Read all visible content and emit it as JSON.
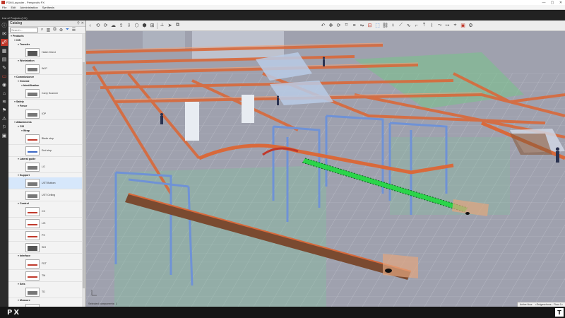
{
  "window": {
    "title": "FDM Layouter - Perspectiv PX",
    "minimize": "—",
    "maximize": "▢",
    "close": "✕"
  },
  "menu": [
    "File",
    "Edit",
    "Administration",
    "Synthesis"
  ],
  "project_label": "List of Projects (1/1)",
  "icons": {
    "sidebar": [
      "info-icon",
      "mail-icon",
      "catalog-icon",
      "grid-icon",
      "document-icon",
      "wrench-icon",
      "folder-icon",
      "eye-icon",
      "house-icon",
      "layers-icon",
      "flag-icon",
      "warning-icon",
      "flag-icon",
      "report-icon"
    ],
    "toolbar": [
      "undo-icon",
      "redo-icon",
      "cloud-icon",
      "cloud-upload-icon",
      "cloud-download-icon",
      "cube-icon",
      "cube-edit-icon",
      "cube-add-icon",
      "measure-icon",
      "arrow-icon",
      "copy-icon"
    ]
  },
  "colors": {
    "accent": "#c0392b",
    "conveyor": "#d9693a",
    "frame": "#6f92d6",
    "select": "#2bd44a"
  },
  "catalog": {
    "title": "Catalog",
    "search_placeholder": "Search...",
    "tree": [
      {
        "type": "group",
        "depth": 0,
        "label": "Products"
      },
      {
        "type": "group",
        "depth": 1,
        "label": "CIS"
      },
      {
        "type": "group",
        "depth": 2,
        "label": "Transfer"
      },
      {
        "type": "item",
        "label": "Hatch Direct",
        "style": "dark"
      },
      {
        "type": "group",
        "depth": 2,
        "label": "Workstation"
      },
      {
        "type": "item",
        "label": "WLP",
        "style": "gray"
      },
      {
        "type": "group",
        "depth": 1,
        "label": "Commissioner"
      },
      {
        "type": "group",
        "depth": 2,
        "label": "General"
      },
      {
        "type": "group",
        "depth": 3,
        "label": "Identification"
      },
      {
        "type": "item",
        "label": "Carry Scanner",
        "style": "gray"
      },
      {
        "type": "group",
        "depth": 1,
        "label": "Safety"
      },
      {
        "type": "group",
        "depth": 2,
        "label": "Fence"
      },
      {
        "type": "item",
        "label": "IOP",
        "style": "gray"
      },
      {
        "type": "group",
        "depth": 1,
        "label": "Attachments"
      },
      {
        "type": "group",
        "depth": 2,
        "label": "CIS"
      },
      {
        "type": "group",
        "depth": 3,
        "label": "Wrap"
      },
      {
        "type": "item",
        "label": "Blade stop",
        "style": "red"
      },
      {
        "type": "item",
        "label": "End stop",
        "style": "blue"
      },
      {
        "type": "group",
        "depth": 2,
        "label": "Lateral guide"
      },
      {
        "type": "item",
        "label": "LG",
        "style": "gray"
      },
      {
        "type": "group",
        "depth": 2,
        "label": "Support"
      },
      {
        "type": "item",
        "label": "UST Bottom",
        "style": "gray",
        "selected": true
      },
      {
        "type": "item",
        "label": "UST Ceiling",
        "style": "gray"
      },
      {
        "type": "group",
        "depth": 2,
        "label": "Control"
      },
      {
        "type": "item",
        "label": "CC",
        "style": "red"
      },
      {
        "type": "item",
        "label": "LIS",
        "style": "red"
      },
      {
        "type": "item",
        "label": "PS",
        "style": "red"
      },
      {
        "type": "item",
        "label": "SIO",
        "style": "dark"
      },
      {
        "type": "group",
        "depth": 2,
        "label": "Interface"
      },
      {
        "type": "item",
        "label": "FDT",
        "style": "red"
      },
      {
        "type": "item",
        "label": "TM",
        "style": "red"
      },
      {
        "type": "group",
        "depth": 2,
        "label": "Sets"
      },
      {
        "type": "item",
        "label": "TD",
        "style": "gray"
      },
      {
        "type": "group",
        "depth": 2,
        "label": "Measure"
      },
      {
        "type": "item",
        "label": "HSK",
        "style": "gray"
      },
      {
        "type": "group",
        "depth": 1,
        "label": "MLC"
      },
      {
        "type": "group",
        "depth": 2,
        "label": "Stop"
      }
    ]
  },
  "viewport": {
    "status": "Selected components: 1",
    "active_floor_label": "Active floor",
    "active_floor_value": "<Erdgeschoss - Floor 1>"
  },
  "brand": {
    "logo": "PX",
    "corner": "T"
  }
}
